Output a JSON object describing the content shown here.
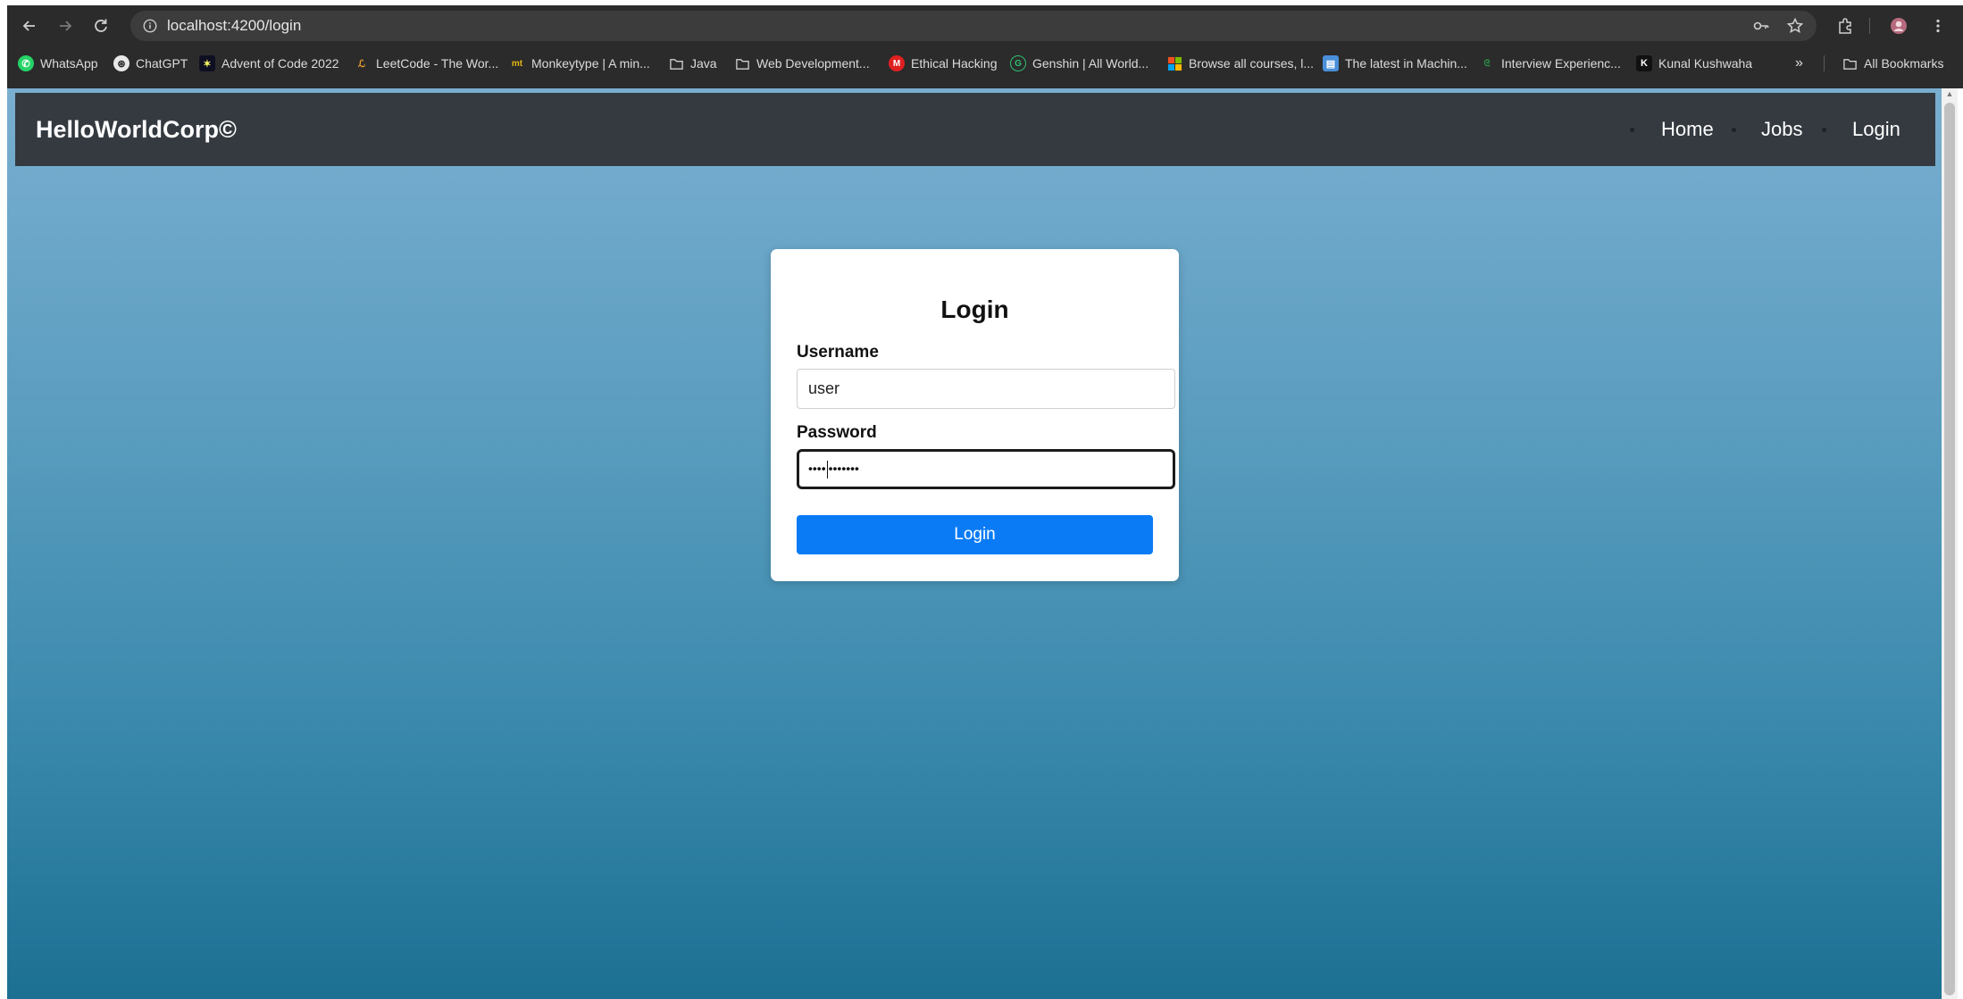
{
  "browser": {
    "url": "localhost:4200/login",
    "bookmarks": [
      {
        "label": "WhatsApp",
        "icon": "whatsapp-icon"
      },
      {
        "label": "ChatGPT",
        "icon": "chatgpt-icon"
      },
      {
        "label": "Advent of Code 2022",
        "icon": "star-icon"
      },
      {
        "label": "LeetCode - The Wor...",
        "icon": "leetcode-icon"
      },
      {
        "label": "Monkeytype | A min...",
        "icon": "monkeytype-icon"
      },
      {
        "label": "Java",
        "icon": "folder-icon"
      },
      {
        "label": "Web Development...",
        "icon": "folder-icon"
      },
      {
        "label": "Ethical Hacking",
        "icon": "hacking-icon"
      },
      {
        "label": "Genshin | All World...",
        "icon": "genshin-icon"
      },
      {
        "label": "Browse all courses, l...",
        "icon": "microsoft-icon"
      },
      {
        "label": "The latest in Machin...",
        "icon": "papers-icon"
      },
      {
        "label": "Interview Experienc...",
        "icon": "gfg-icon"
      },
      {
        "label": "Kunal Kushwaha",
        "icon": "k-icon"
      }
    ],
    "more_bookmarks_glyph": "»",
    "all_bookmarks_label": "All Bookmarks"
  },
  "navbar": {
    "brand": "HelloWorldCorp©",
    "links": [
      "Home",
      "Jobs",
      "Login"
    ]
  },
  "login_form": {
    "title": "Login",
    "username_label": "Username",
    "username_value": "user",
    "password_label": "Password",
    "password_masked_before_caret": "••••",
    "password_masked_after_caret": "•••••••",
    "submit_label": "Login"
  },
  "colors": {
    "navbar_bg": "#343a40",
    "button_bg": "#0a7bf5",
    "page_gradient_top": "#79aed0",
    "page_gradient_bottom": "#1c7092"
  }
}
